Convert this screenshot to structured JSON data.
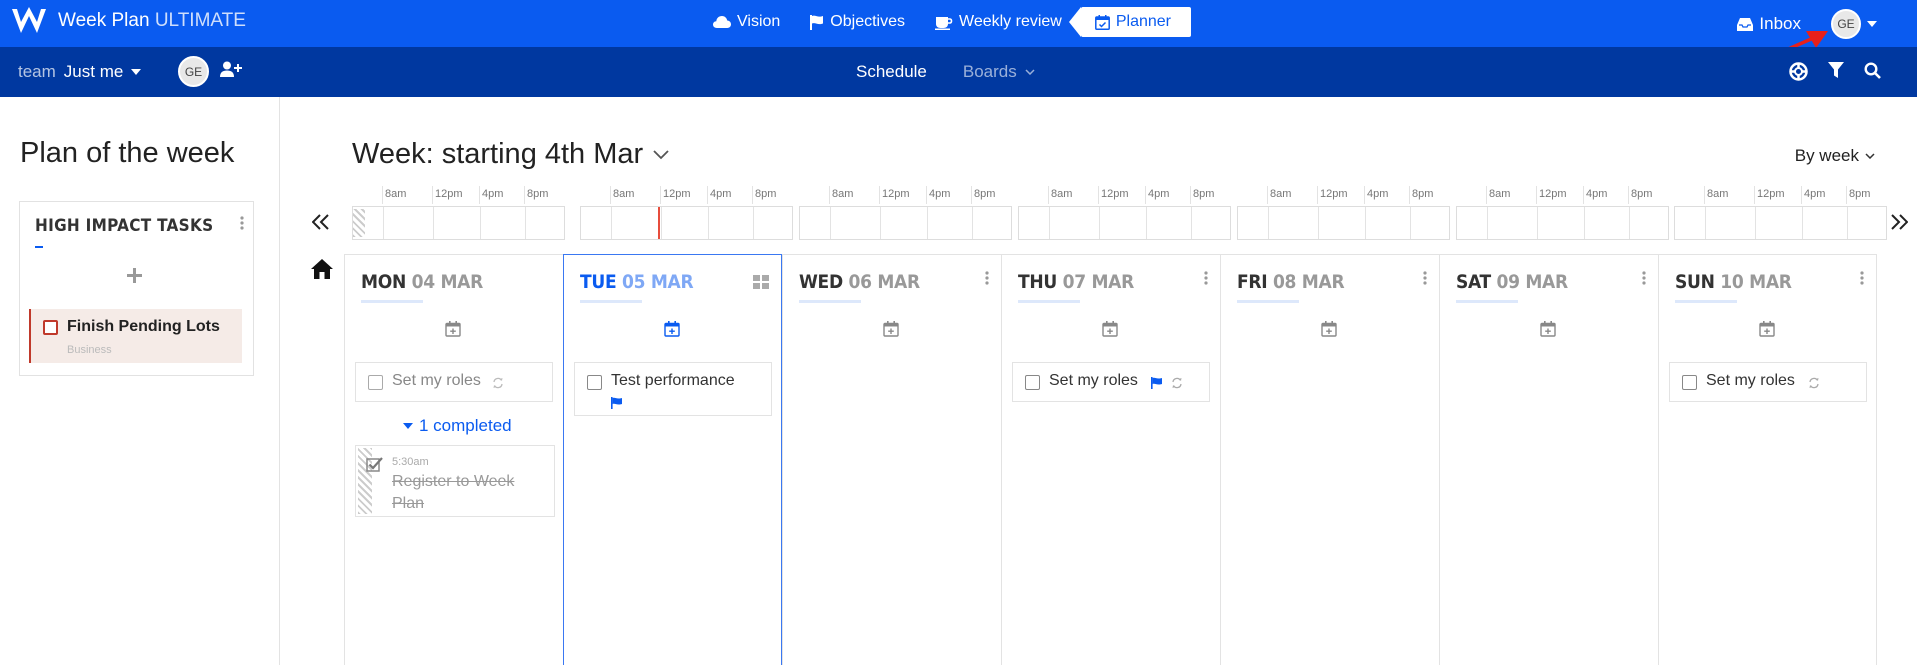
{
  "app": {
    "brand_name": "Week Plan",
    "brand_tier": "ULTIMATE"
  },
  "topnav": {
    "items": [
      {
        "label": "Vision",
        "icon": "cloud-icon"
      },
      {
        "label": "Objectives",
        "icon": "flag-icon"
      },
      {
        "label": "Weekly review",
        "icon": "coffee-icon"
      },
      {
        "label": "Planner",
        "icon": "calendar-check-icon",
        "active": true
      }
    ],
    "inbox_label": "Inbox",
    "user_initials": "GE"
  },
  "subbar": {
    "team_label": "team",
    "team_value": "Just me",
    "member_initials": "GE",
    "schedule_label": "Schedule",
    "boards_label": "Boards"
  },
  "sidebar": {
    "title": "Plan of the week",
    "card_title": "HIGH IMPACT TASKS",
    "task_name": "Finish Pending Lots",
    "task_category": "Business"
  },
  "main": {
    "week_title": "Week: starting 4th Mar",
    "view_mode": "By week",
    "timeline_labels": [
      "8am",
      "12pm",
      "4pm",
      "8pm"
    ]
  },
  "days": [
    {
      "name": "MON",
      "date": "04 MAR"
    },
    {
      "name": "TUE",
      "date": "05 MAR",
      "today": true
    },
    {
      "name": "WED",
      "date": "06 MAR"
    },
    {
      "name": "THU",
      "date": "07 MAR"
    },
    {
      "name": "FRI",
      "date": "08 MAR"
    },
    {
      "name": "SAT",
      "date": "09 MAR"
    },
    {
      "name": "SUN",
      "date": "10 MAR"
    }
  ],
  "tasks": {
    "mon_role": "Set my roles",
    "tue_task": "Test performance",
    "thu_role": "Set my roles",
    "sun_role": "Set my roles",
    "completed_label": "1 completed",
    "done_time": "5:30am",
    "done_name": "Register to Week Plan"
  },
  "colors": {
    "topbar": "#0a5bf0",
    "subbar": "#0038a0",
    "accent": "#0a5bf0",
    "priority": "#c0392b"
  }
}
